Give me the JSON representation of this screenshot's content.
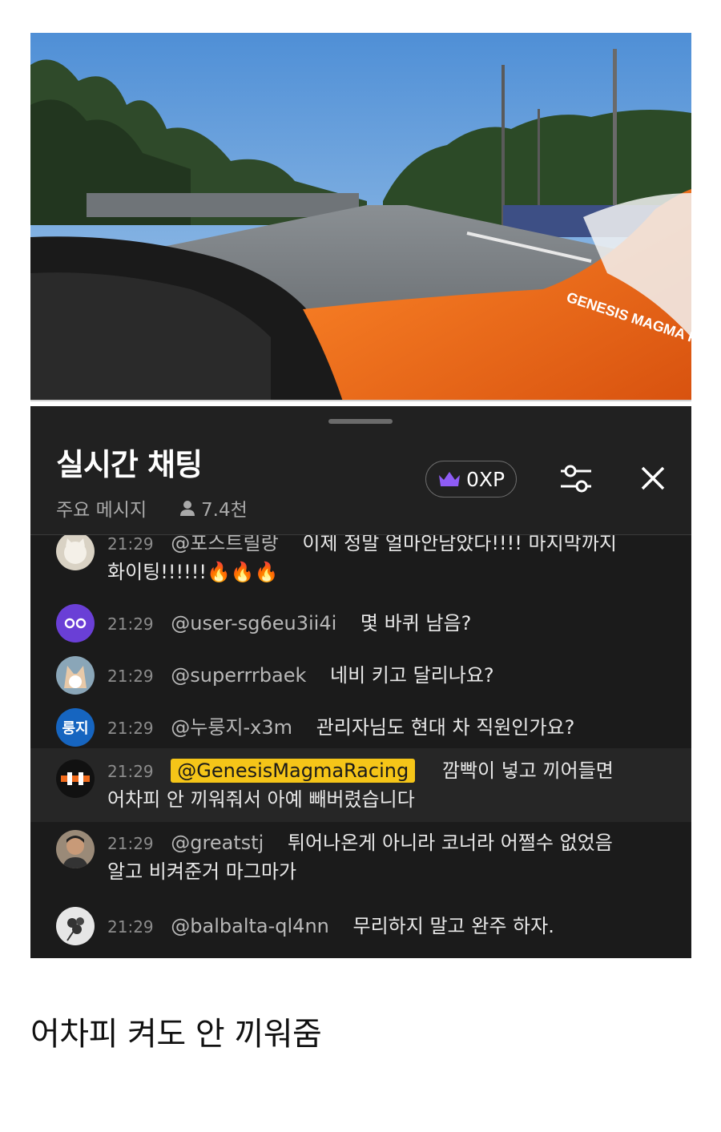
{
  "chat": {
    "title": "실시간 채팅",
    "mode_label": "주요 메시지",
    "viewer_count": "7.4천",
    "xp_label": "0XP",
    "messages": [
      {
        "time": "21:29",
        "author": "@포스트릴랑",
        "text": "이제 정말 얼마안남았다!!!! 마지막까지",
        "text2": "화이팅!!!!!!🔥🔥🔥",
        "avatar": "cat-avatar"
      },
      {
        "time": "21:29",
        "author": "@user-sg6eu3ii4i",
        "text": "몇 바퀴 남음?",
        "avatar": "purple-eyes-avatar"
      },
      {
        "time": "21:29",
        "author": "@superrrbaek",
        "text": "네비 키고 달리나요?",
        "avatar": "fox-avatar"
      },
      {
        "time": "21:29",
        "author": "@누룽지-x3m",
        "text": "관리자님도 현대 차 직원인가요?",
        "avatar_text": "룽지",
        "avatar": "text-avatar"
      },
      {
        "time": "21:29",
        "author": "@GenesisMagmaRacing",
        "text": "깜빡이 넣고 끼어들면",
        "text2": "어차피 안 끼워줘서 아예 빼버렸습니다",
        "avatar": "team-logo-avatar"
      },
      {
        "time": "21:29",
        "author": "@greatstj",
        "text": "튀어나온게 아니라 코너라 어쩔수 없었음",
        "text2": "알고 비켜준거 마그마가",
        "avatar": "person-avatar"
      },
      {
        "time": "21:29",
        "author": "@balbalta-ql4nn",
        "text": "무리하지 말고 완주 하자.",
        "avatar": "flower-avatar"
      }
    ]
  },
  "caption": "어차피 켜도 안 끼워줌",
  "colors": {
    "owner_badge": "#f5c518",
    "crown": "#8e5cf5",
    "car_orange": "#ef6a1c"
  },
  "video": {
    "livery_text": "GENESIS MAGMA RACING"
  }
}
